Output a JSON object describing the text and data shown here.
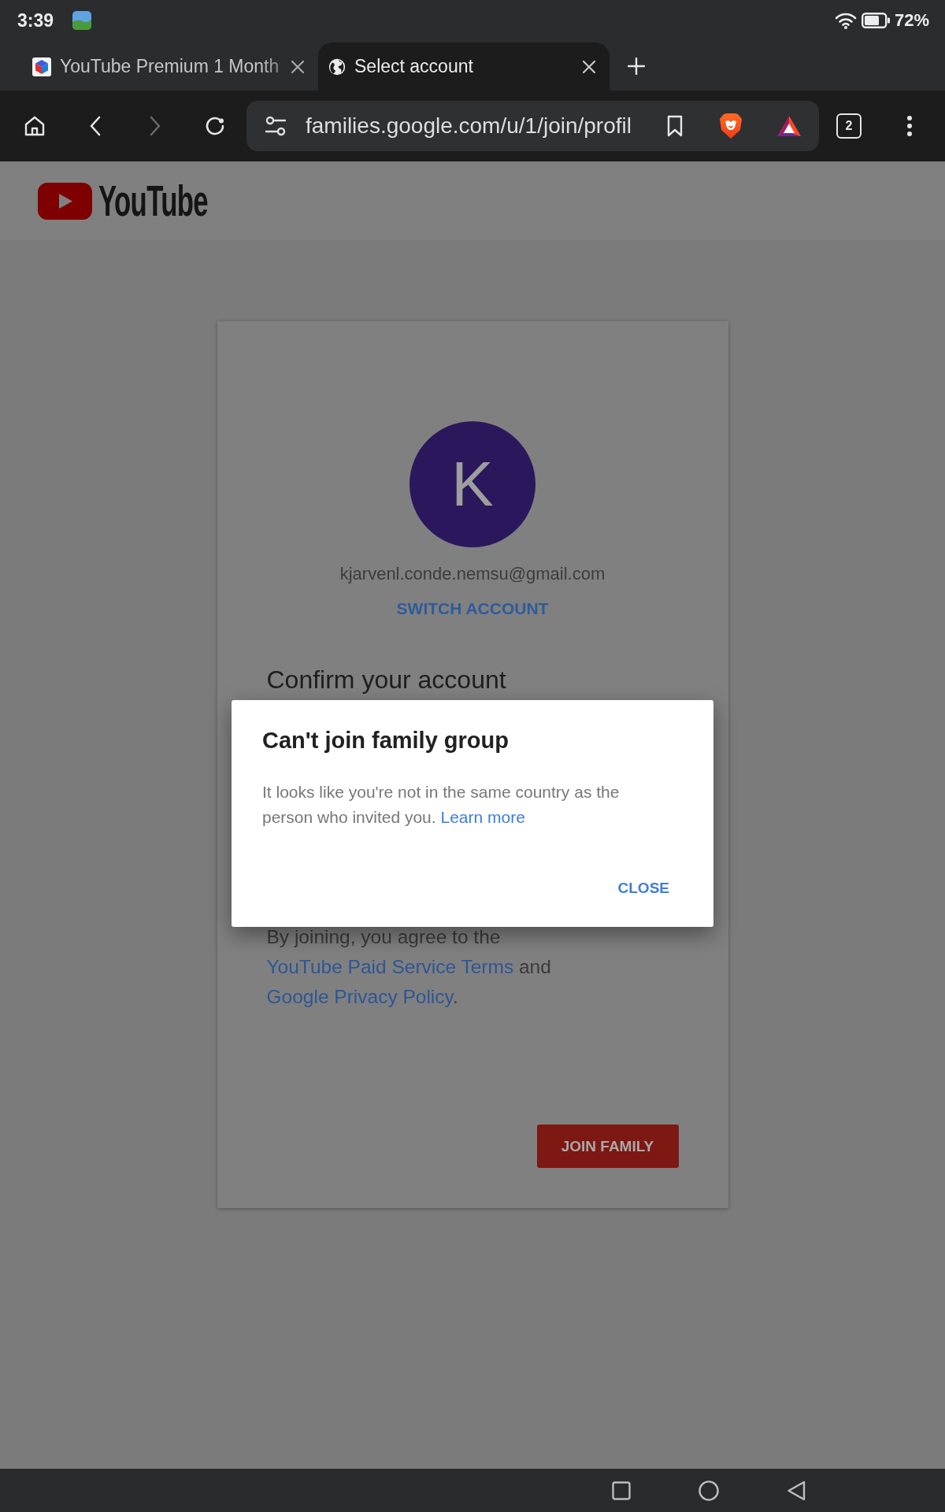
{
  "status_bar": {
    "time": "3:39",
    "battery": "72%"
  },
  "tabs": [
    {
      "title": "YouTube Premium 1 Month",
      "kind": "favicon",
      "selected": false
    },
    {
      "title": "Select account",
      "kind": "globe",
      "selected": true
    }
  ],
  "toolbar": {
    "back": {
      "disabled": false
    },
    "forward": {
      "disabled": true
    },
    "url": "families.google.com/u/1/join/profil",
    "tab_count": "2"
  },
  "page": {
    "logo": "YouTube",
    "account": {
      "initial": "K",
      "email": "kjarvenl.conde.nemsu@gmail.com",
      "switch_account": "SWITCH ACCOUNT"
    },
    "heading": "Confirm your account",
    "terms": [
      {
        "kind": "text",
        "text": "By joining, you agree to the "
      },
      {
        "kind": "link",
        "text": "YouTube Paid Service Terms"
      },
      {
        "kind": "text",
        "text": " and "
      },
      {
        "kind": "link",
        "text": "Google Privacy Policy"
      },
      {
        "kind": "text",
        "text": "."
      }
    ],
    "join_button": "JOIN FAMILY"
  },
  "dialog": {
    "title": "Can't join family group",
    "body": [
      {
        "kind": "text",
        "text": "It looks like you're not in the same country as the person who invited you. "
      },
      {
        "kind": "link",
        "text": "Learn more"
      }
    ],
    "close_button": "CLOSE"
  }
}
